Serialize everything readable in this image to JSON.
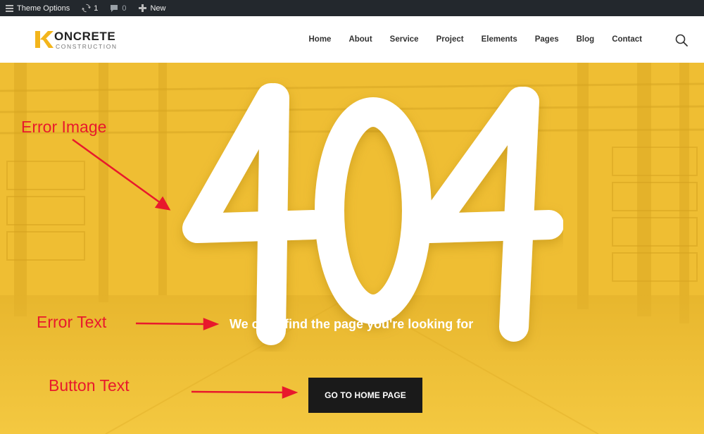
{
  "adminbar": {
    "theme_options": "Theme Options",
    "updates_count": "1",
    "comments_count": "0",
    "new_label": "New"
  },
  "logo": {
    "name": "ONCRETE",
    "sub": "CONSTRUCTION",
    "mark_color": "#f3b51b"
  },
  "nav": {
    "items": [
      "Home",
      "About",
      "Service",
      "Project",
      "Elements",
      "Pages",
      "Blog",
      "Contact"
    ]
  },
  "hero": {
    "error_code": "404",
    "message": "We can't find the page you're looking for",
    "button_label": "GO TO HOME PAGE",
    "accent": "#f2c23a"
  },
  "annotations": {
    "image": "Error Image",
    "text": "Error Text",
    "button": "Button Text",
    "color": "#e8192c"
  }
}
